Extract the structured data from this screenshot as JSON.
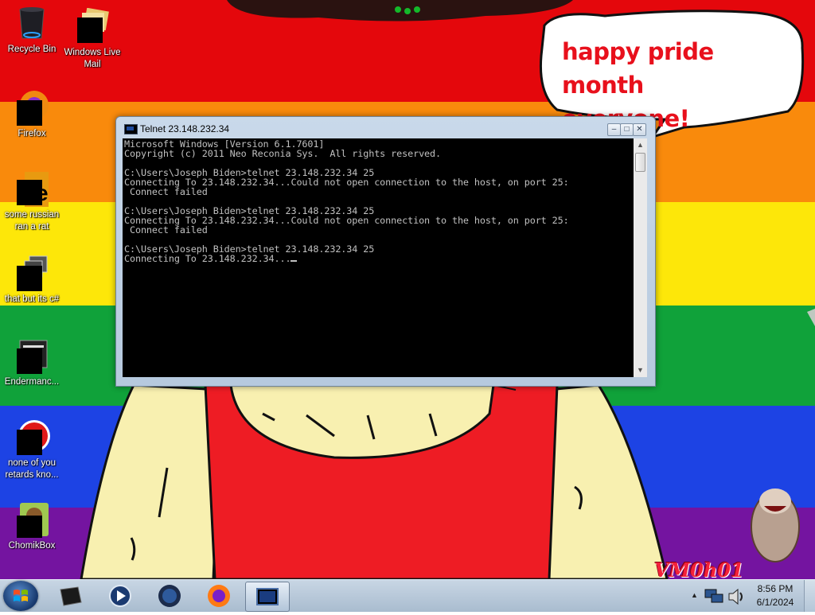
{
  "wallpaper": {
    "bubble_text_line1": "happy pride month",
    "bubble_text_line2": "everyone!",
    "watermark": "VM0h01"
  },
  "desktop_icons": [
    {
      "label": "Recycle Bin",
      "icon": "recycle-bin-icon"
    },
    {
      "label": "Windows Live Mail",
      "icon": "mail-icon"
    },
    {
      "label": "Firefox",
      "icon": "firefox-icon"
    },
    {
      "label": "some russian ran a rat",
      "icon": "ie-icon"
    },
    {
      "label": "that but its c#",
      "icon": "window-stack-icon"
    },
    {
      "label": "Endermanc...",
      "icon": "app-window-icon"
    },
    {
      "label": "none of you retards kno...",
      "icon": "red-circle-icon"
    },
    {
      "label": "ChomikBox",
      "icon": "chomikbox-icon"
    }
  ],
  "window": {
    "title": "Telnet 23.148.232.34",
    "console_lines": [
      "Microsoft Windows [Version 6.1.7601]",
      "Copyright (c) 2011 Neo Reconia Sys.  All rights reserved.",
      "",
      "C:\\Users\\Joseph Biden>telnet 23.148.232.34 25",
      "Connecting To 23.148.232.34...Could not open connection to the host, on port 25:",
      " Connect failed",
      "",
      "C:\\Users\\Joseph Biden>telnet 23.148.232.34 25",
      "Connecting To 23.148.232.34...Could not open connection to the host, on port 25:",
      " Connect failed",
      "",
      "C:\\Users\\Joseph Biden>telnet 23.148.232.34 25",
      "Connecting To 23.148.232.34..."
    ]
  },
  "taskbar": {
    "pinned": [
      "terminal-icon",
      "media-player-icon",
      "globe-browser-icon",
      "firefox-icon",
      "telnet-window-icon"
    ],
    "active_item": "telnet-window-icon"
  },
  "clock": {
    "time": "8:56 PM",
    "date": "6/1/2024"
  }
}
